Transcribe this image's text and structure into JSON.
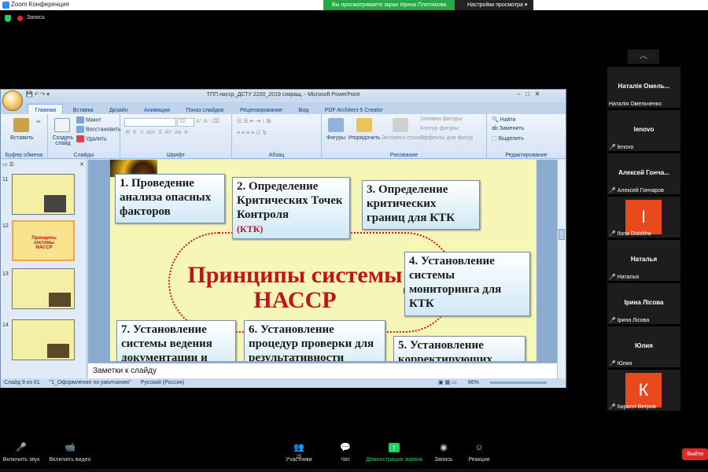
{
  "zoom": {
    "window_title": "Zoom Конференция",
    "viewing_banner": "Вы просматриваете экран Ирина Плотнікова",
    "view_settings": "Настройки просмотра",
    "recording_label": "Запись"
  },
  "ppt": {
    "title": "ТПП насср_ДСТУ 2200_2019 сокращ. - Microsoft PowerPoint",
    "tabs": [
      "Главная",
      "Вставка",
      "Дизайн",
      "Анимация",
      "Показ слайдов",
      "Рецензирование",
      "Вид",
      "PDF Architect 5 Creator"
    ],
    "ribbon": {
      "clipboard": {
        "paste": "Вставить",
        "label": "Буфер обмена"
      },
      "slides": {
        "create": "Создать слайд",
        "layout": "Макет",
        "restore": "Восстановить",
        "delete": "Удалить",
        "label": "Слайды"
      },
      "font": {
        "size": "32",
        "label": "Шрифт"
      },
      "paragraph": {
        "label": "Абзац"
      },
      "drawing": {
        "shapes": "Фигуры",
        "arrange": "Упорядочить",
        "quick_styles": "Экспресс-стили",
        "fill": "Заливка фигуры",
        "outline": "Контур фигуры",
        "effects": "Эффекты для фигур",
        "label": "Рисование"
      },
      "editing": {
        "find": "Найти",
        "replace": "Заменить",
        "select": "Выделить",
        "label": "Редактирование"
      }
    },
    "thumbnail_numbers": [
      "11",
      "12",
      "13",
      "14"
    ],
    "thumb12_text": "Принципы системы НАССР",
    "slide": {
      "main_title": "Принципы системы НАССР",
      "box1": "1. Проведение анализа опасных факторов",
      "box2": "2. Определение Критических Точек Контроля",
      "box2_sub": "(КТК)",
      "box3": "3. Определение критических границ для КТК",
      "box4": "4. Установление системы мониторинга для КТК",
      "box5": "5. Установление корректирующих",
      "box6": "6. Установление процедур проверки для результативности",
      "box7": "7. Установление системы ведения документации и"
    },
    "notes_placeholder": "Заметки к слайду",
    "status": {
      "slide": "Слайд 9 из 61",
      "theme": "\"1_Оформление по умолчанию\"",
      "lang": "Русский (Россия)",
      "zoom": "86%"
    }
  },
  "participants": [
    {
      "display": "Наталія Омель...",
      "label": "Наталія Омельченко",
      "muted": false,
      "avatar": "",
      "color": ""
    },
    {
      "display": "lenovo",
      "label": "lenovo",
      "muted": true,
      "avatar": "",
      "color": ""
    },
    {
      "display": "Алексей Гонча...",
      "label": "Алексей Гончаров",
      "muted": true,
      "avatar": "",
      "color": ""
    },
    {
      "display": "",
      "label": "Ilona Didokha",
      "muted": true,
      "avatar": "I",
      "color": "#e8491d"
    },
    {
      "display": "Наталья",
      "label": "Наталья",
      "muted": true,
      "avatar": "",
      "color": ""
    },
    {
      "display": "Ірина Лісова",
      "label": "Ірина Лісова",
      "muted": true,
      "avatar": "",
      "color": ""
    },
    {
      "display": "Юлия",
      "label": "Юлия",
      "muted": true,
      "avatar": "",
      "color": ""
    },
    {
      "display": "",
      "label": "Кирилл Ветров",
      "muted": true,
      "avatar": "К",
      "color": "#e8491d"
    }
  ],
  "toolbar": {
    "unmute": "Включить звук",
    "start_video": "Включить видео",
    "participants": "Участники",
    "participants_count": "25",
    "chat": "Чат",
    "share": "Демонстрация экрана",
    "record": "Запись",
    "reactions": "Реакции",
    "leave": "Выйти"
  }
}
